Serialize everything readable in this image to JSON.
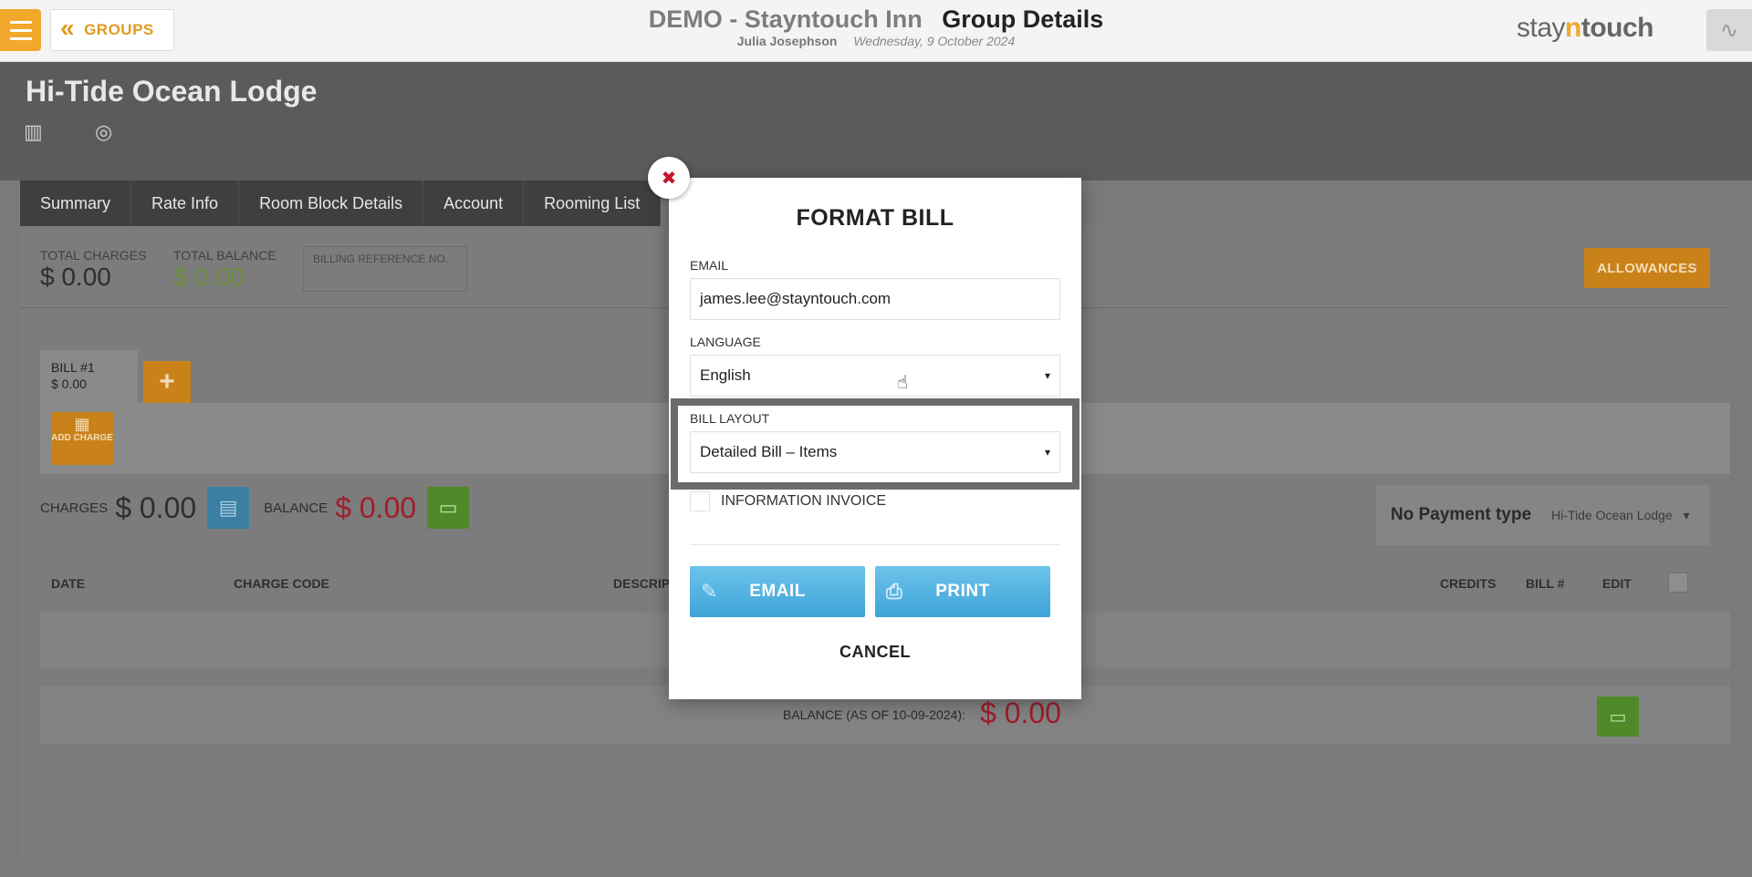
{
  "header": {
    "back_label": "GROUPS",
    "hotel_name": "DEMO - Stayntouch Inn",
    "page_title": "Group Details",
    "user_name": "Julia Josephson",
    "date": "Wednesday, 9 October 2024",
    "brand_stay": "stay",
    "brand_n": "n",
    "brand_touch": "touch"
  },
  "group": {
    "name": "Hi-Tide Ocean Lodge"
  },
  "tabs": [
    "Summary",
    "Rate Info",
    "Room Block Details",
    "Account",
    "Rooming List"
  ],
  "totals": {
    "total_charges_label": "TOTAL CHARGES",
    "total_charges_value": "$ 0.00",
    "total_balance_label": "TOTAL BALANCE",
    "total_balance_value": "$ 0.00",
    "billing_ref_placeholder": "BILLING REFERENCE NO.",
    "allowances_label": "ALLOWANCES"
  },
  "bill": {
    "tab_label": "BILL #1",
    "tab_value": "$ 0.00",
    "add_bill": "+",
    "add_charge_label": "ADD CHARGE",
    "charges_label": "CHARGES",
    "charges_value": "$ 0.00",
    "balance_label": "BALANCE",
    "balance_value": "$ 0.00",
    "payment_type": "No Payment type",
    "payment_account": "Hi-Tide Ocean Lodge",
    "columns": {
      "date": "DATE",
      "charge_code": "CHARGE CODE",
      "description": "DESCRIP",
      "credits": "CREDITS",
      "bill_no": "BILL #",
      "edit": "EDIT"
    },
    "balance_asof_label": "BALANCE (AS OF 10-09-2024):",
    "balance_asof_value": "$ 0.00"
  },
  "modal": {
    "title": "FORMAT BILL",
    "email_label": "EMAIL",
    "email_value": "james.lee@stayntouch.com",
    "language_label": "LANGUAGE",
    "language_value": "English",
    "layout_label": "BILL LAYOUT",
    "layout_value": "Detailed Bill – Items",
    "invoice_label": "INFORMATION INVOICE",
    "email_button": "EMAIL",
    "print_button": "PRINT",
    "cancel_button": "CANCEL",
    "close_icon": "✖"
  },
  "colors": {
    "accent_orange": "#f1a82b",
    "button_blue": "#4fb1e0",
    "balance_red": "#a01d2b",
    "wallet_green": "#4f8a2a"
  }
}
